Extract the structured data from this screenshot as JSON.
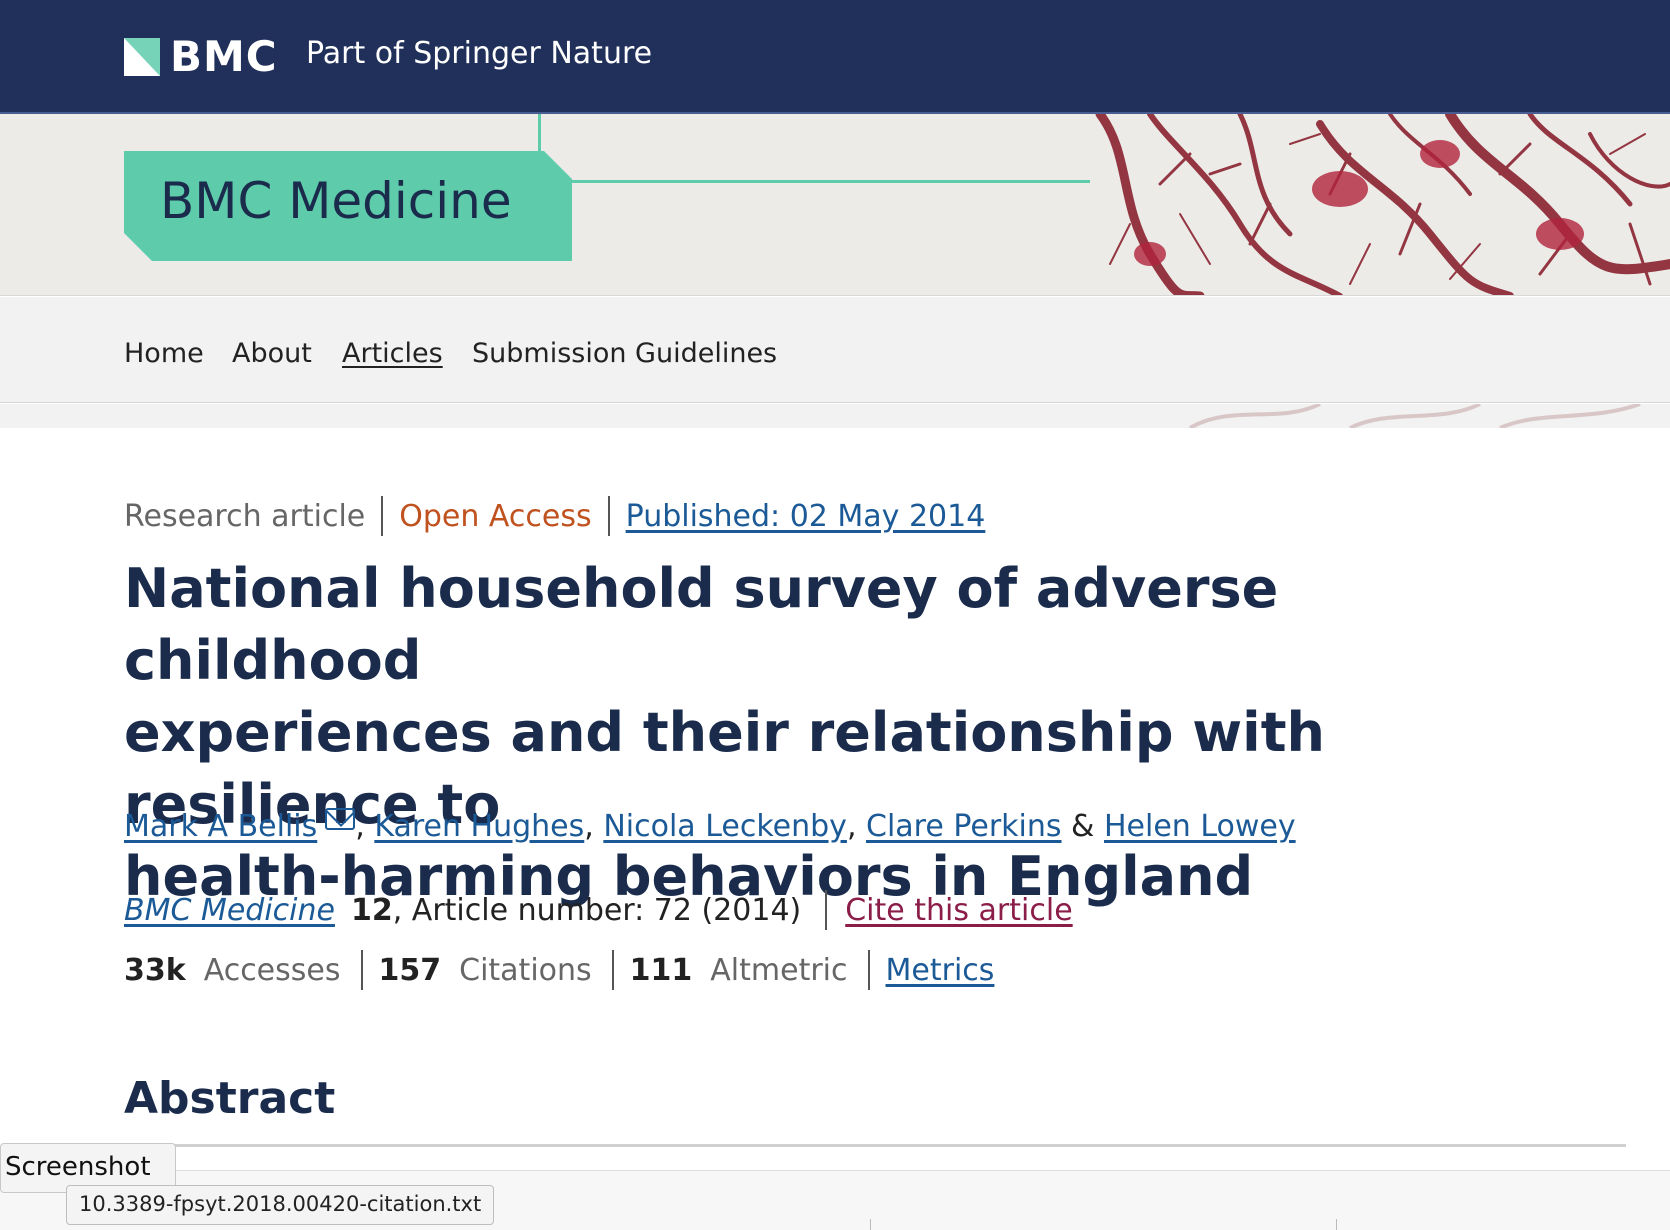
{
  "header": {
    "brand": "BMC",
    "tagline": "Part of Springer Nature"
  },
  "journal": {
    "name": "BMC Medicine"
  },
  "nav": {
    "items": [
      {
        "label": "Home"
      },
      {
        "label": "About"
      },
      {
        "label": "Articles",
        "active": true
      },
      {
        "label": "Submission Guidelines"
      }
    ]
  },
  "article": {
    "type": "Research article",
    "access": "Open Access",
    "published": "Published: 02 May 2014",
    "title_lines": [
      "National household survey of adverse childhood",
      "experiences and their relationship with resilience to",
      "health-harming behaviors in England"
    ],
    "authors": [
      {
        "name": "Mark A Bellis",
        "has_email": true
      },
      {
        "name": "Karen Hughes"
      },
      {
        "name": "Nicola Leckenby"
      },
      {
        "name": "Clare Perkins"
      },
      {
        "name": "Helen Lowey"
      }
    ],
    "author_separator": ", ",
    "author_last_separator": " & ",
    "citation": {
      "journal": "BMC Medicine",
      "volume": "12",
      "details": ", Article number: 72 (2014)",
      "cite_label": "Cite this article"
    },
    "metrics": {
      "accesses_value": "33k",
      "accesses_label": "Accesses",
      "citations_value": "157",
      "citations_label": "Citations",
      "altmetric_value": "111",
      "altmetric_label": "Altmetric",
      "metrics_link": "Metrics"
    },
    "abstract_heading": "Abstract"
  },
  "overlay": {
    "tooltip": "Screenshot",
    "download_file": "10.3389-fpsyt.2018.00420-citation.txt"
  },
  "colors": {
    "header_bg": "#21305a",
    "accent": "#5ecbab",
    "title": "#1a2b4c",
    "link": "#1b5a96",
    "open_access": "#c0521f",
    "cite": "#8b1d49"
  },
  "icons": [
    "bmc-logo-icon",
    "email-icon"
  ]
}
